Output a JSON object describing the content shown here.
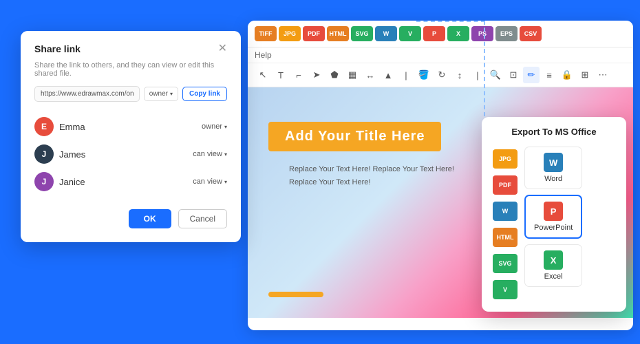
{
  "app": {
    "background_color": "#1a6dff"
  },
  "format_toolbar": {
    "badges": [
      {
        "label": "TIFF",
        "class": "tiff"
      },
      {
        "label": "JPG",
        "class": "jpg"
      },
      {
        "label": "PDF",
        "class": "pdf"
      },
      {
        "label": "HTML",
        "class": "html"
      },
      {
        "label": "SVG",
        "class": "svg"
      },
      {
        "label": "W",
        "class": "wdoc"
      },
      {
        "label": "V",
        "class": "vsdx"
      },
      {
        "label": "P",
        "class": "ppt"
      },
      {
        "label": "X",
        "class": "xlsx"
      },
      {
        "label": "PS",
        "class": "ps"
      },
      {
        "label": "EPS",
        "class": "eps"
      },
      {
        "label": "CSV",
        "class": "csv"
      }
    ]
  },
  "help_bar": {
    "label": "Help"
  },
  "slide": {
    "title": "Add Your Title Here",
    "text_line1": "Replace Your Text Here! Replace Your Text Here!",
    "text_line2": "Replace Your Text Here!"
  },
  "share_dialog": {
    "title": "Share link",
    "description": "Share the link to others, and they can view or edit this shared file.",
    "link_url": "https://www.edrawmax.com/online/fil",
    "link_role": "owner",
    "copy_button": "Copy link",
    "users": [
      {
        "name": "Emma",
        "avatar_class": "emma",
        "role": "owner",
        "initials": "E"
      },
      {
        "name": "James",
        "avatar_class": "james",
        "role": "can view",
        "initials": "J"
      },
      {
        "name": "Janice",
        "avatar_class": "janice",
        "role": "can view",
        "initials": "J"
      }
    ],
    "ok_button": "OK",
    "cancel_button": "Cancel"
  },
  "export_panel": {
    "title": "Export To MS Office",
    "side_icons": [
      {
        "label": "JPG",
        "class": "jpg2"
      },
      {
        "label": "PDF",
        "class": "pdf2"
      },
      {
        "label": "W",
        "class": "word2"
      },
      {
        "label": "HTML",
        "class": "html2"
      },
      {
        "label": "SVG",
        "class": "svg2"
      },
      {
        "label": "V",
        "class": "v2"
      }
    ],
    "items": [
      {
        "label": "Word",
        "icon_class": "ei-word",
        "icon_text": "W",
        "active": false
      },
      {
        "label": "PowerPoint",
        "icon_class": "ei-ppt",
        "icon_text": "P",
        "active": true
      },
      {
        "label": "Excel",
        "icon_class": "ei-xlsx",
        "icon_text": "X",
        "active": false
      }
    ]
  }
}
